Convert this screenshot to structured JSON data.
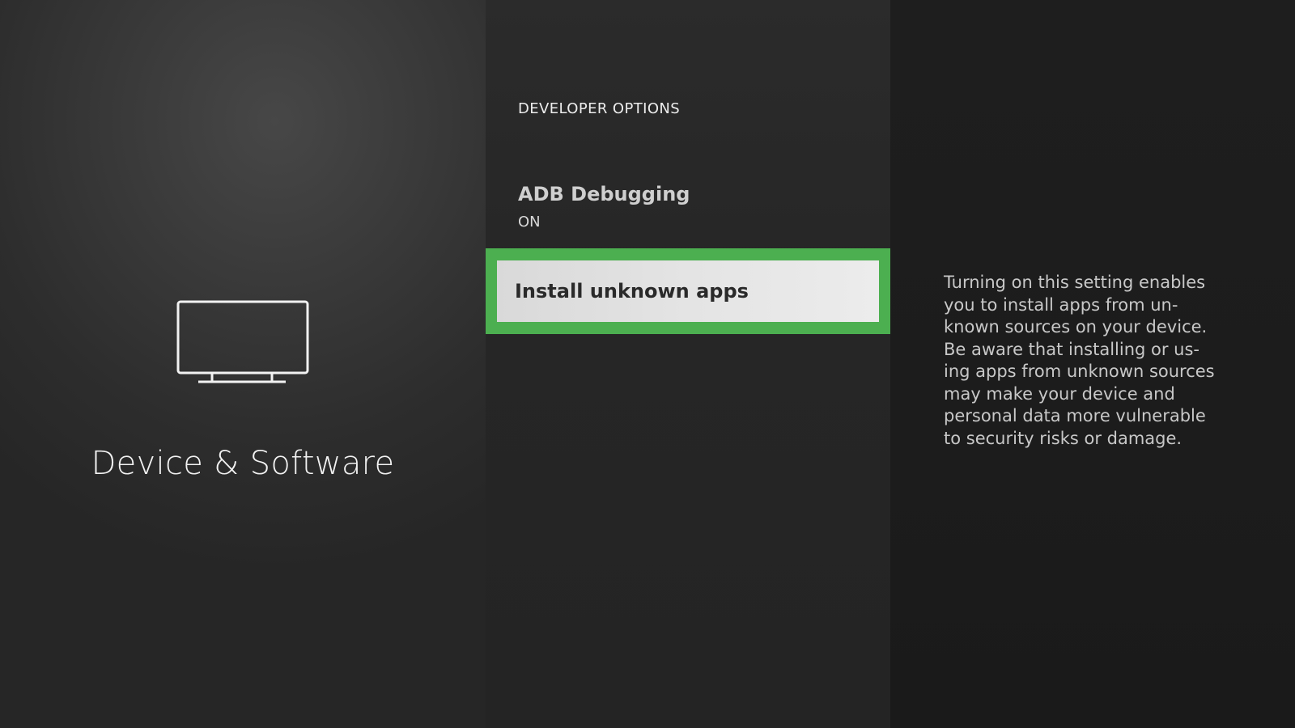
{
  "left_panel": {
    "icon": "tv-icon",
    "title": "Device & Software"
  },
  "menu": {
    "header": "DEVELOPER OPTIONS",
    "items": [
      {
        "title": "ADB Debugging",
        "status": "ON",
        "selected": false
      },
      {
        "title": "Install unknown apps",
        "selected": true
      }
    ]
  },
  "description": {
    "text": "Turning on this setting enables you to install apps from un-known sources on your device. Be aware that installing or us-ing apps from unknown sources may make your device and personal data more vulnerable to security risks or damage."
  },
  "colors": {
    "focus_border": "#4caf50",
    "focus_fill": "#e4e4e4"
  }
}
